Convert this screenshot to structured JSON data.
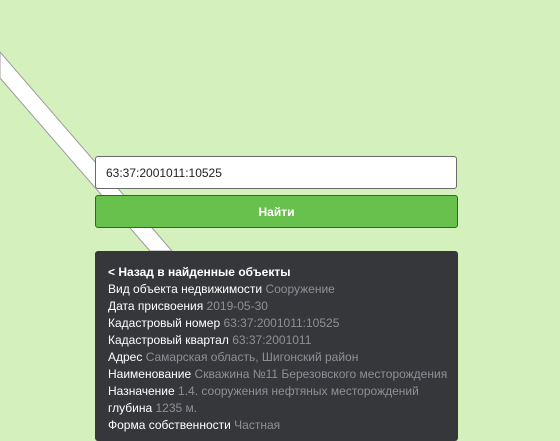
{
  "search": {
    "value": "63:37:2001011:10525",
    "button_label": "Найти"
  },
  "panel": {
    "back_label": "< Назад в найденные объекты",
    "fields": [
      {
        "label": "Вид объекта недвижимости",
        "value": "Сооружение"
      },
      {
        "label": "Дата присвоения",
        "value": "2019-05-30"
      },
      {
        "label": "Кадастровый номер",
        "value": "63:37:2001011:10525"
      },
      {
        "label": "Кадастровый квартал",
        "value": "63:37:2001011"
      },
      {
        "label": "Адрес",
        "value": "Самарская область, Шигонский район"
      },
      {
        "label": "Наименование",
        "value": "Скважина №11 Березовского месторождения"
      },
      {
        "label": "Назначение",
        "value": "1.4. сооружения нефтяных месторождений"
      },
      {
        "label": "глубина",
        "value": "1235 м."
      },
      {
        "label": "Форма собственности",
        "value": "Частная"
      }
    ]
  },
  "colors": {
    "map_background": "#d4f0bd",
    "road": "#ffffff",
    "button": "#68c14c",
    "panel": "#36373b",
    "value_text": "#8e9095"
  }
}
